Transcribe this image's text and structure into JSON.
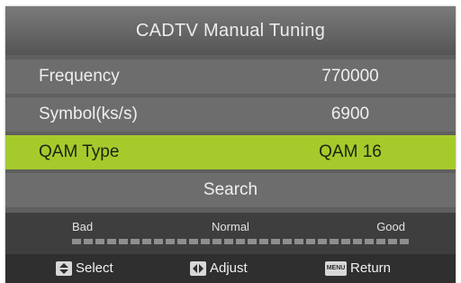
{
  "title": "CADTV Manual Tuning",
  "rows": [
    {
      "label": "Frequency",
      "value": "770000"
    },
    {
      "label": "Symbol(ks/s)",
      "value": "6900"
    },
    {
      "label": "QAM Type",
      "value": "QAM 16",
      "highlighted": true
    }
  ],
  "search_label": "Search",
  "signal": {
    "bad_label": "Bad",
    "normal_label": "Normal",
    "good_label": "Good",
    "level": 0
  },
  "footer": {
    "select_label": "Select",
    "adjust_label": "Adjust",
    "return_label": "Return",
    "menu_key_text": "MENU"
  },
  "colors": {
    "highlight": "#a6ca2c",
    "row_bg": "#6d6d6d",
    "panel_bg": "#5f5f5f"
  }
}
